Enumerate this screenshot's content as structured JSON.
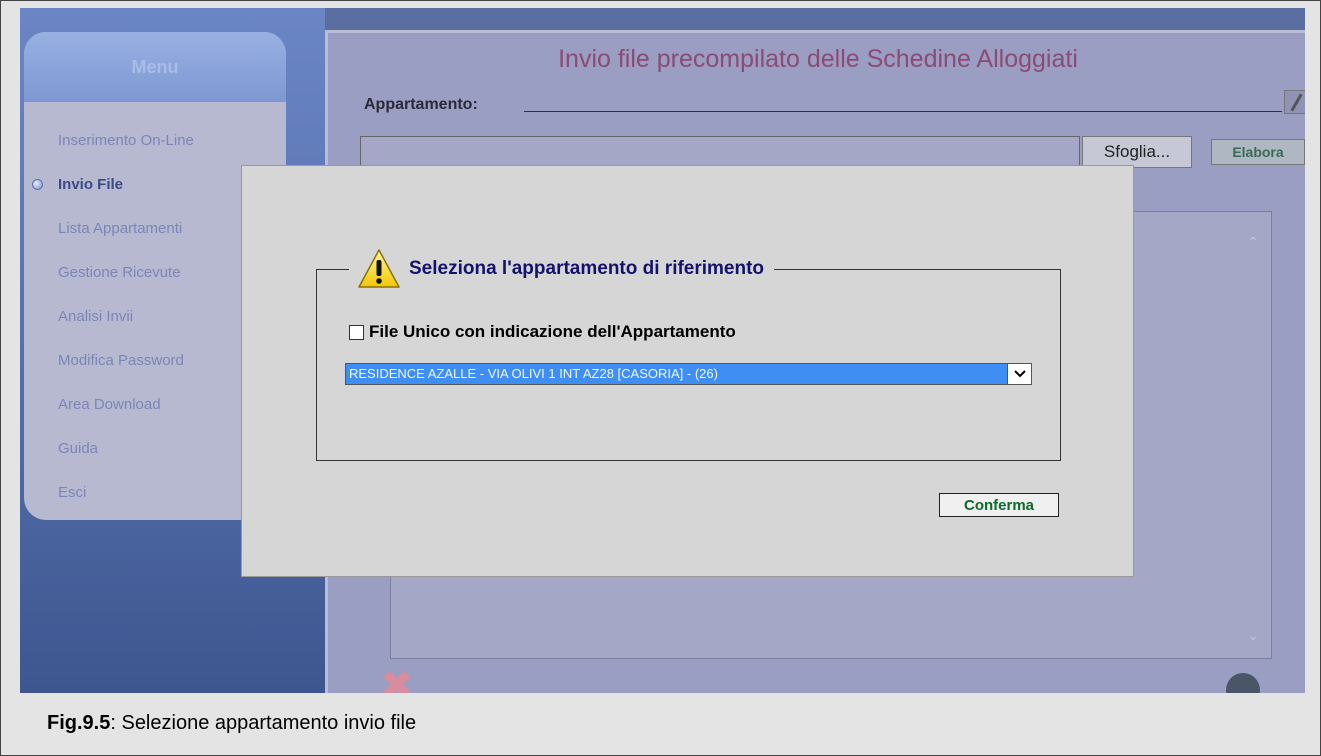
{
  "app": {
    "title": "Invio file precompilato delle Schedine Alloggiati",
    "apartment_label": "Appartamento:",
    "browse_label": "Sfoglia...",
    "process_label": "Elabora"
  },
  "sidebar": {
    "title": "Menu",
    "items": [
      {
        "label": "Inserimento On-Line",
        "active": false
      },
      {
        "label": "Invio File",
        "active": true
      },
      {
        "label": "Lista Appartamenti",
        "active": false
      },
      {
        "label": "Gestione Ricevute",
        "active": false
      },
      {
        "label": "Analisi Invii",
        "active": false
      },
      {
        "label": "Modifica Password",
        "active": false
      },
      {
        "label": "Area Download",
        "active": false
      },
      {
        "label": "Guida",
        "active": false
      },
      {
        "label": "Esci",
        "active": false
      }
    ]
  },
  "dialog": {
    "legend": "Seleziona l'appartamento di riferimento",
    "checkbox_label": "File Unico con indicazione dell'Appartamento",
    "checkbox_checked": false,
    "select_value": "RESIDENCE AZALLE - VIA OLIVI 1 INT AZ28 [CASORIA] - (26)",
    "confirm_label": "Conferma"
  },
  "icons": {
    "warning": "warning-icon",
    "dropdown": "chevron-down-icon",
    "edit": "pencil-icon"
  },
  "colors": {
    "title": "#8c4a74",
    "dialog_legend": "#13136e",
    "confirm_text": "#0b6b2a",
    "select_highlight": "#3e8ef4"
  },
  "caption": {
    "figure": "Fig.9.5",
    "text": ": Selezione appartamento invio file"
  }
}
